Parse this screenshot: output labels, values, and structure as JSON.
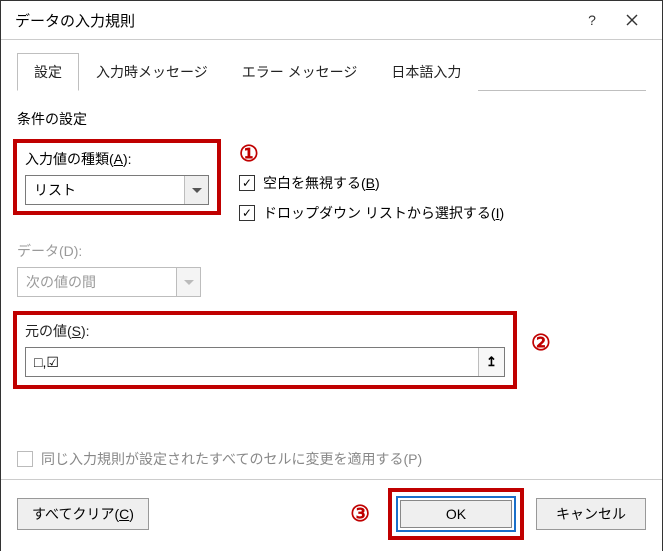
{
  "window": {
    "title": "データの入力規則"
  },
  "tabs": {
    "settings": "設定",
    "input_msg": "入力時メッセージ",
    "error_msg": "エラー メッセージ",
    "ime": "日本語入力"
  },
  "section": {
    "criteria": "条件の設定"
  },
  "fields": {
    "allow_label_pre": "入力値の種類(",
    "allow_key": "A",
    "allow_label_post": "):",
    "allow_value": "リスト",
    "data_label": "データ(D):",
    "data_value": "次の値の間",
    "source_label_pre": "元の値(",
    "source_key": "S",
    "source_label_post": "):",
    "source_value": "□,☑"
  },
  "checks": {
    "ignore_blank_pre": "空白を無視する(",
    "ignore_blank_key": "B",
    "ignore_blank_post": ")",
    "dropdown_pre": "ドロップダウン リストから選択する(",
    "dropdown_key": "I",
    "dropdown_post": ")",
    "propagate_pre": "同じ入力規則が設定されたすべてのセルに変更を適用する(",
    "propagate_key": "P",
    "propagate_post": ")"
  },
  "buttons": {
    "clear_pre": "すべてクリア(",
    "clear_key": "C",
    "clear_post": ")",
    "ok": "OK",
    "cancel": "キャンセル"
  },
  "badges": {
    "one": "①",
    "two": "②",
    "three": "③"
  },
  "icons": {
    "check": "✓",
    "ref": "↥"
  }
}
